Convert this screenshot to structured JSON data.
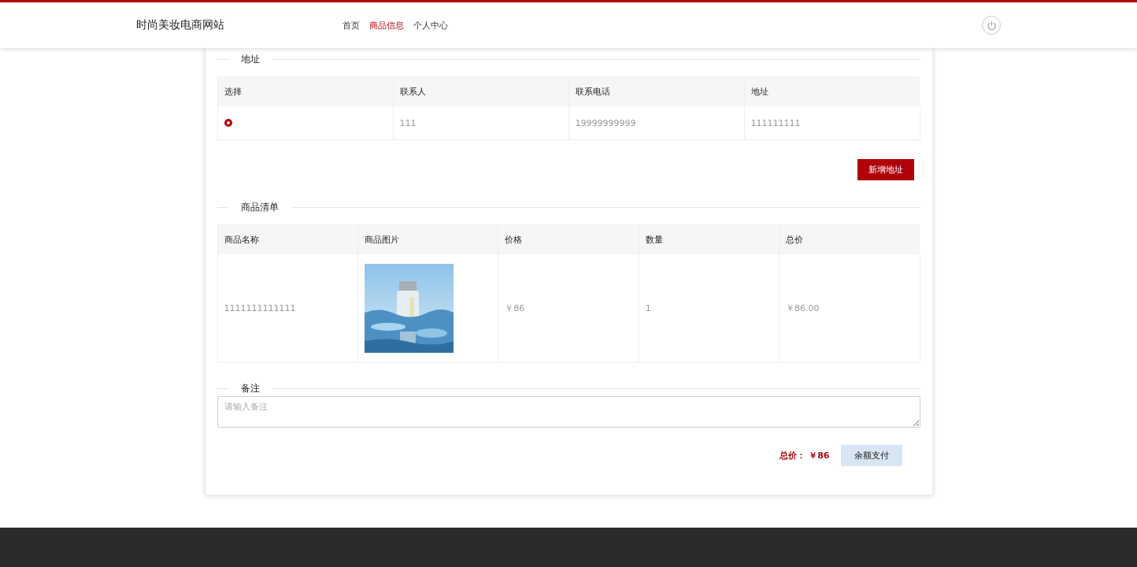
{
  "header": {
    "site_title": "时尚美妆电商网站",
    "nav": [
      {
        "label": "首页",
        "selected": false
      },
      {
        "label": "商品信息",
        "selected": true
      },
      {
        "label": "个人中心",
        "selected": false
      }
    ]
  },
  "address_section": {
    "title": "地址",
    "columns": [
      "选择",
      "联系人",
      "联系电话",
      "地址"
    ],
    "rows": [
      {
        "selected": true,
        "contact": "111",
        "phone": "19999999999",
        "address": "111111111"
      }
    ],
    "add_button": "新增地址"
  },
  "goods_section": {
    "title": "商品清单",
    "columns": [
      "商品名称",
      "商品图片",
      "价格",
      "数量",
      "总价"
    ],
    "rows": [
      {
        "name": "1111111111111",
        "price": "￥86",
        "quantity": "1",
        "total": "￥86.00"
      }
    ]
  },
  "remark": {
    "title": "备注",
    "placeholder": "请输入备注"
  },
  "checkout": {
    "total_label": "总价：",
    "total_value": "￥86",
    "pay_button": "余额支付"
  }
}
